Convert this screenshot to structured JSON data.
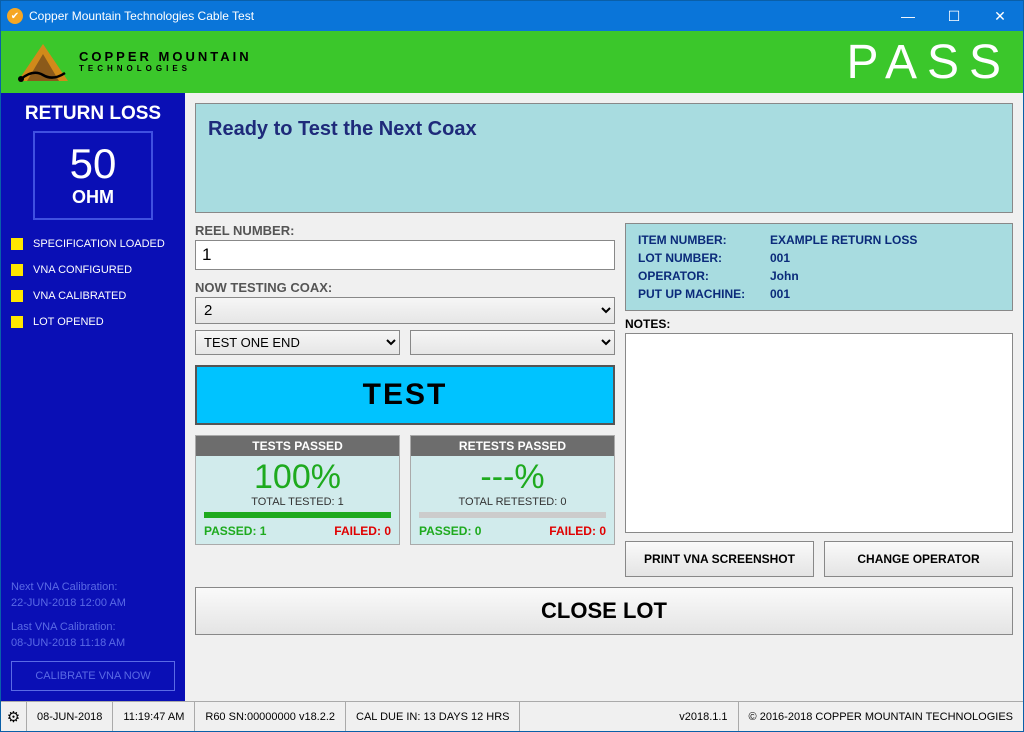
{
  "window": {
    "title": "Copper Mountain Technologies Cable Test"
  },
  "header": {
    "brand_line1": "COPPER MOUNTAIN",
    "brand_line2": "TECHNOLOGIES",
    "pass_label": "PASS"
  },
  "sidebar": {
    "title": "RETURN LOSS",
    "impedance_value": "50",
    "impedance_unit": "OHM",
    "statuses": [
      "SPECIFICATION LOADED",
      "VNA CONFIGURED",
      "VNA CALIBRATED",
      "LOT OPENED"
    ],
    "next_cal_label": "Next VNA Calibration:",
    "next_cal_value": "22-JUN-2018 12:00 AM",
    "last_cal_label": "Last VNA Calibration:",
    "last_cal_value": "08-JUN-2018 11:18 AM",
    "calibrate_btn": "CALIBRATE VNA NOW"
  },
  "banner": {
    "message": "Ready to Test the Next Coax"
  },
  "form": {
    "reel_label": "REEL NUMBER:",
    "reel_value": "1",
    "testing_label": "NOW TESTING COAX:",
    "coax_value": "2",
    "end_value": "TEST ONE END",
    "secondary_value": "",
    "test_btn": "TEST"
  },
  "stats": {
    "tests": {
      "header": "TESTS PASSED",
      "percent": "100%",
      "total_label": "TOTAL TESTED: 1",
      "passed_label": "PASSED:",
      "passed_value": "1",
      "failed_label": "FAILED:",
      "failed_value": "0"
    },
    "retests": {
      "header": "RETESTS PASSED",
      "percent": "---%",
      "total_label": "TOTAL RETESTED: 0",
      "passed_label": "PASSED:",
      "passed_value": "0",
      "failed_label": "FAILED:",
      "failed_value": "0"
    }
  },
  "info": {
    "item_k": "ITEM NUMBER:",
    "item_v": "EXAMPLE RETURN LOSS",
    "lot_k": "LOT NUMBER:",
    "lot_v": "001",
    "op_k": "OPERATOR:",
    "op_v": "John",
    "mach_k": "PUT UP MACHINE:",
    "mach_v": "001"
  },
  "notes": {
    "label": "NOTES:",
    "value": ""
  },
  "buttons": {
    "print": "PRINT VNA SCREENSHOT",
    "change_op": "CHANGE OPERATOR",
    "close_lot": "CLOSE LOT"
  },
  "statusbar": {
    "date": "08-JUN-2018",
    "time": "11:19:47 AM",
    "device": "R60  SN:00000000  v18.2.2",
    "cal_due": "CAL DUE IN: 13 DAYS 12 HRS",
    "version": "v2018.1.1",
    "copyright": "© 2016-2018 COPPER MOUNTAIN TECHNOLOGIES"
  }
}
